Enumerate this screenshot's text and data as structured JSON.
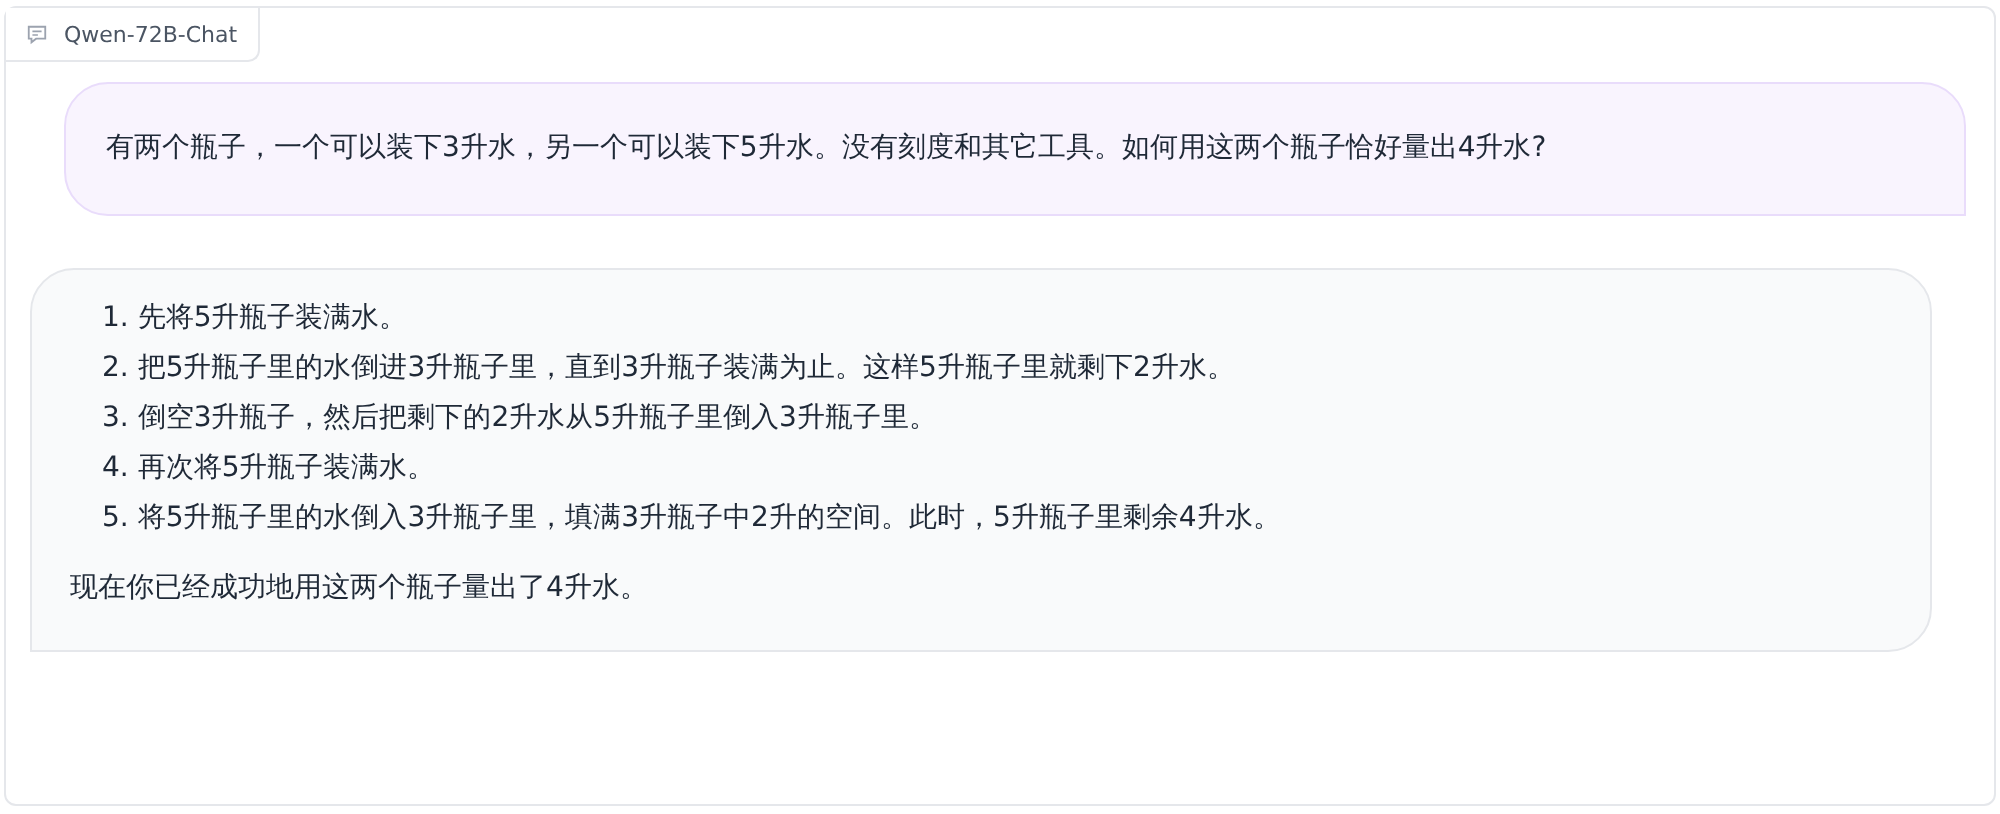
{
  "label": "Qwen-72B-Chat",
  "messages": [
    {
      "kind": "user",
      "paragraphs": [
        "有两个瓶子，一个可以装下3升水，另一个可以装下5升水。没有刻度和其它工具。如何用这两个瓶子恰好量出4升水?"
      ]
    },
    {
      "kind": "bot",
      "list": [
        {
          "number": "1.",
          "text": "先将5升瓶子装满水。"
        },
        {
          "number": "2.",
          "text": "把5升瓶子里的水倒进3升瓶子里，直到3升瓶子装满为止。这样5升瓶子里就剩下2升水。"
        },
        {
          "number": "3.",
          "text": "倒空3升瓶子，然后把剩下的2升水从5升瓶子里倒入3升瓶子里。"
        },
        {
          "number": "4.",
          "text": "再次将5升瓶子装满水。"
        },
        {
          "number": "5.",
          "text": "将5升瓶子里的水倒入3升瓶子里，填满3升瓶子中2升的空间。此时，5升瓶子里剩余4升水。"
        }
      ],
      "paragraphs": [
        "现在你已经成功地用这两个瓶子量出了4升水。"
      ]
    }
  ]
}
